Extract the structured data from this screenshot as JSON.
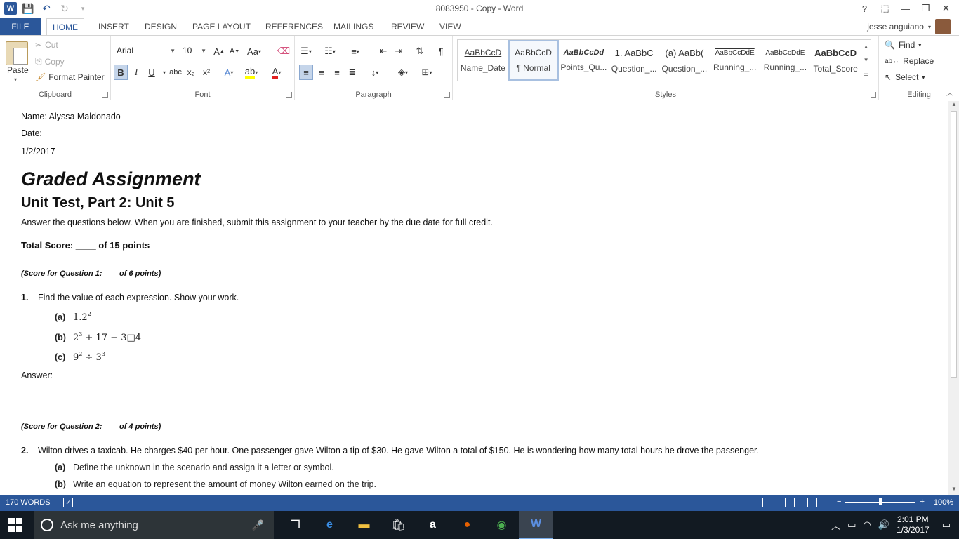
{
  "window": {
    "title": "8083950 - Copy - Word",
    "help": "?",
    "minimize": "—",
    "restore": "❐",
    "close": "✕"
  },
  "tabs": [
    "FILE",
    "HOME",
    "INSERT",
    "DESIGN",
    "PAGE LAYOUT",
    "REFERENCES",
    "MAILINGS",
    "REVIEW",
    "VIEW"
  ],
  "user": {
    "name": "jesse anguiano"
  },
  "clipboard": {
    "paste": "Paste",
    "cut": "Cut",
    "copy": "Copy",
    "format_painter": "Format Painter",
    "label": "Clipboard"
  },
  "font": {
    "family": "Arial",
    "size": "10",
    "label": "Font",
    "grow": "A",
    "shrink": "A",
    "case": "Aa",
    "bold": "B",
    "italic": "I",
    "underline": "U",
    "strike": "abc",
    "subscript": "x₂",
    "superscript": "x²",
    "font_color": "A",
    "highlight_color": "#ffff00",
    "font_color_value": "#e02020"
  },
  "paragraph": {
    "label": "Paragraph",
    "pilcrow": "¶"
  },
  "styles": {
    "label": "Styles",
    "items": [
      {
        "preview": "AaBbCcD",
        "name": "Name_Date"
      },
      {
        "preview": "AaBbCcD",
        "name": "¶ Normal"
      },
      {
        "preview": "AaBbCcDd",
        "name": "Points_Qu..."
      },
      {
        "preview": "1. AaBbC",
        "name": "Question_..."
      },
      {
        "preview": "(a) AaBb(",
        "name": "Question_..."
      },
      {
        "preview": "AaBbCcDdE",
        "name": "Running_..."
      },
      {
        "preview": "AaBbCcDdE",
        "name": "Running_..."
      },
      {
        "preview": "AaBbCcD",
        "name": "Total_Score"
      }
    ]
  },
  "editing": {
    "label": "Editing",
    "find": "Find",
    "replace": "Replace",
    "select": "Select"
  },
  "document": {
    "name_line": "Name: Alyssa Maldonado",
    "date_label": "Date:",
    "date_value": "1/2/2017",
    "title": "Graded Assignment",
    "subtitle": "Unit Test, Part 2: Unit 5",
    "instructions": "Answer the questions below. When you are finished, submit this assignment to your teacher by the due date for full credit.",
    "total_score": "Total Score: ____ of 15 points",
    "q1_score": "(Score for Question 1: ___ of 6 points)",
    "q1_num": "1.",
    "q1_text": "Find the value of each expression. Show your work.",
    "q1_a_label": "(a)",
    "q1_a_base": "1.2",
    "q1_a_exp": "2",
    "q1_b_label": "(b)",
    "q1_b_base": "2",
    "q1_b_exp": "3",
    "q1_b_rest": " + 17 − 3□4",
    "q1_c_label": "(c)",
    "q1_c_base": "9",
    "q1_c_exp": "2",
    "q1_c_mid": " ÷ 3",
    "q1_c_exp2": "3",
    "answer_label": "Answer:",
    "q2_score": "(Score for Question 2: ___ of 4 points)",
    "q2_num": "2.",
    "q2_text": "Wilton drives a taxicab. He charges $40 per hour. One passenger gave Wilton a tip of $30. He gave Wilton a total of $150. He is wondering how many total hours he drove the passenger.",
    "q2_a_label": "(a)",
    "q2_a_text": "Define the unknown in the scenario and assign it a letter or symbol.",
    "q2_b_label": "(b)",
    "q2_b_text": "Write an equation to represent the amount of money Wilton earned on the trip."
  },
  "status": {
    "words": "170 WORDS",
    "zoom": "100%",
    "zoom_level": 0.5
  },
  "taskbar": {
    "search_placeholder": "Ask me anything",
    "time": "2:01 PM",
    "date": "1/3/2017"
  }
}
